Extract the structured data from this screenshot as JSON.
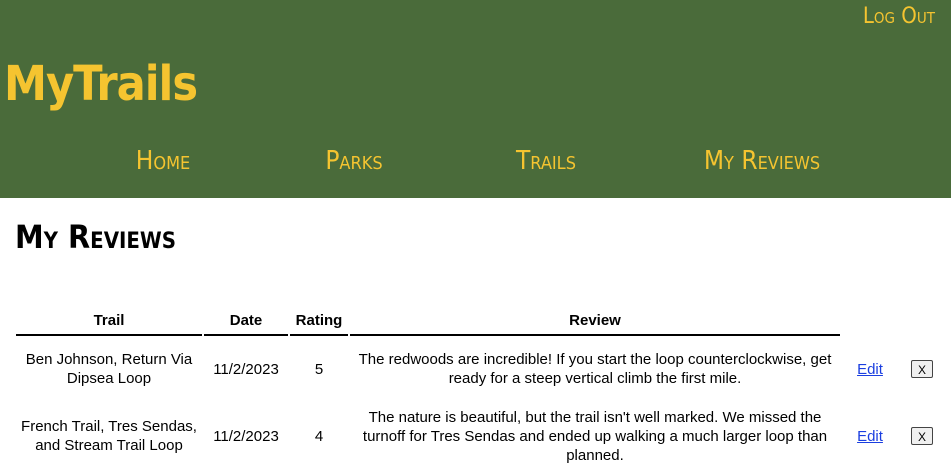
{
  "header": {
    "logout_label": "Log Out",
    "brand": "MyTrails",
    "nav": [
      {
        "label": "Home"
      },
      {
        "label": "Parks"
      },
      {
        "label": "Trails"
      },
      {
        "label": "My Reviews"
      }
    ]
  },
  "main": {
    "title": "My Reviews",
    "table": {
      "columns": [
        "Trail",
        "Date",
        "Rating",
        "Review"
      ],
      "rows": [
        {
          "trail": "Ben Johnson, Return Via Dipsea Loop",
          "date": "11/2/2023",
          "rating": "5",
          "review": "The redwoods are incredible! If you start the loop counterclockwise, get ready for a steep vertical climb the first mile.",
          "edit_label": "Edit",
          "delete_label": "X"
        },
        {
          "trail": "French Trail, Tres Sendas, and Stream Trail Loop",
          "date": "11/2/2023",
          "rating": "4",
          "review": "The nature is beautiful, but the trail isn't well marked. We missed the turnoff for Tres Sendas and ended up walking a much larger loop than planned.",
          "edit_label": "Edit",
          "delete_label": "X"
        }
      ]
    }
  },
  "colors": {
    "header_bg": "#4a6b3a",
    "accent": "#f5c430",
    "link": "#1a3ee0"
  }
}
